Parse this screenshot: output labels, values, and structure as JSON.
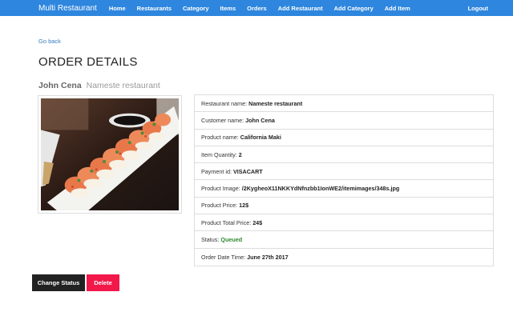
{
  "navbar": {
    "brand": "Multi Restaurant",
    "items": [
      "Home",
      "Restaurants",
      "Category",
      "Items",
      "Orders",
      "Add Restaurant",
      "Add Category",
      "Add Item"
    ],
    "logout": "Logout",
    "color": "#2e86de"
  },
  "go_back": "Go back",
  "page_title": "ORDER DETAILS",
  "header": {
    "customer": "John Cena",
    "restaurant": "Nameste restaurant"
  },
  "image": {
    "icon": "sushi-photo"
  },
  "details": [
    {
      "label": "Restaurant name:",
      "value": "Nameste restaurant"
    },
    {
      "label": "Customer name:",
      "value": "John Cena"
    },
    {
      "label": "Product name:",
      "value": "California Maki"
    },
    {
      "label": "Item Quantity:",
      "value": "2"
    },
    {
      "label": "Payment id:",
      "value": "VISACART"
    },
    {
      "label": "Product Image:",
      "value": "/2KygheoX11NKKYdNfnzbb1IonWE2/itemimages/348s.jpg"
    },
    {
      "label": "Product Price:",
      "value": "12$"
    },
    {
      "label": "Product Total Price:",
      "value": "24$"
    },
    {
      "label": "Status:",
      "value": "Queued"
    },
    {
      "label": "Order Date Time:",
      "value": "June 27th 2017"
    }
  ],
  "status_color": "#2f8a2f",
  "buttons": {
    "change_status": "Change Status",
    "delete": "Delete",
    "delete_color": "#f2184a"
  }
}
